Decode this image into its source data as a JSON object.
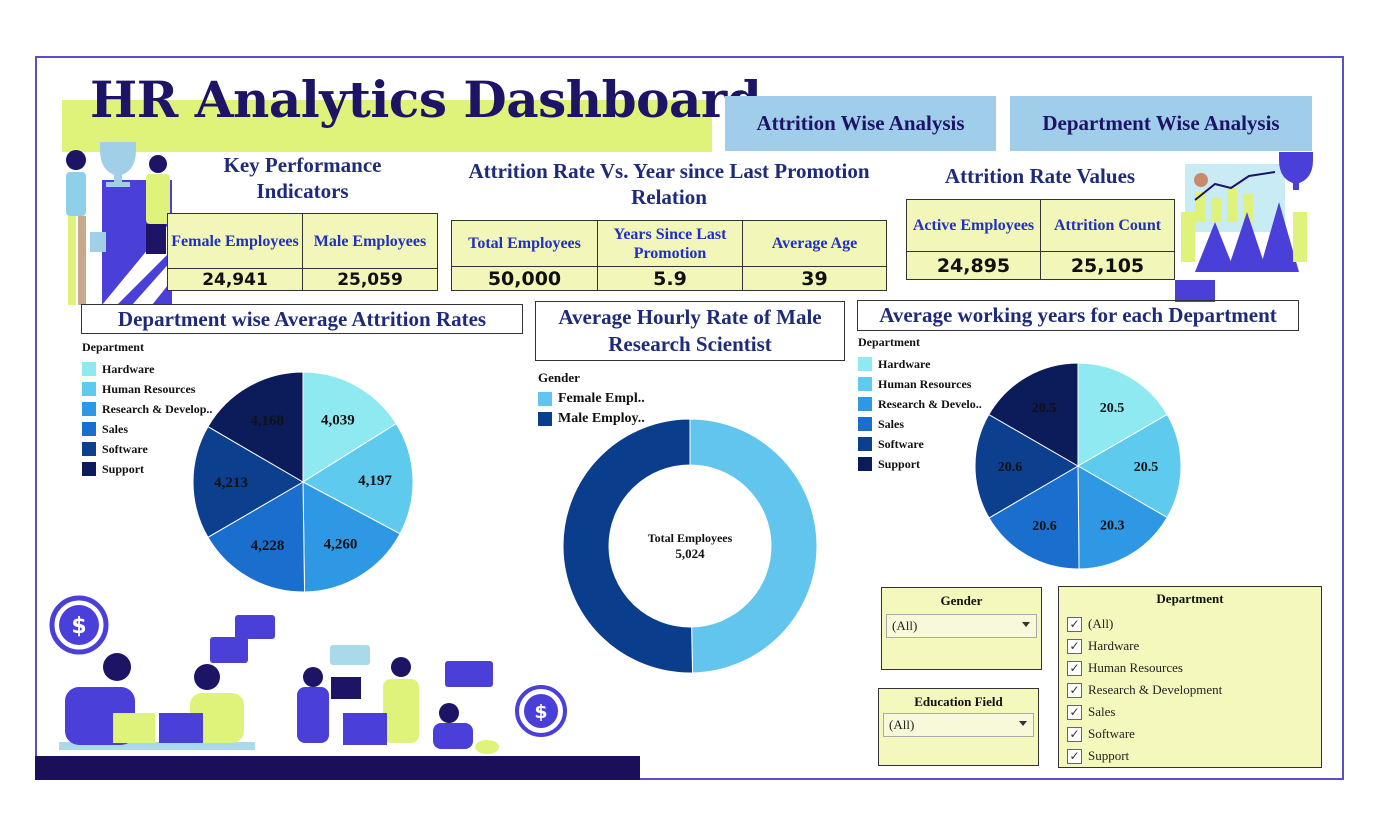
{
  "header": {
    "title": "HR Analytics Dashboard"
  },
  "nav": {
    "attrition_btn": "Attrition Wise Analysis",
    "department_btn": "Department Wise Analysis"
  },
  "kpi": {
    "heading_line1": "Key Performance",
    "heading_line2": "Indicators",
    "female_label": "Female Employees",
    "male_label": "Male Employees",
    "female_value": "24,941",
    "male_value": "25,059"
  },
  "promotion": {
    "heading_line1": "Attrition Rate Vs. Year since Last Promotion",
    "heading_line2": "Relation",
    "total_label": "Total Employees",
    "years_label": "Years Since Last Promotion",
    "age_label": "Average Age",
    "total_value": "50,000",
    "years_value": "5.9",
    "age_value": "39"
  },
  "attrition_values": {
    "heading": "Attrition Rate Values",
    "active_label": "Active Employees",
    "count_label": "Attrition Count",
    "active_value": "24,895",
    "count_value": "25,105"
  },
  "colors": {
    "hardware": "#8eeaf0",
    "human_resources": "#5ecbee",
    "research": "#2e98e4",
    "sales": "#1a6fce",
    "software": "#0d3f8f",
    "support": "#0c1c5a",
    "female": "#62c5ee",
    "male": "#0a3d8c"
  },
  "chart_data": [
    {
      "type": "pie",
      "title": "Department wise Average Attrition Rates",
      "legend_title": "Department",
      "categories": [
        "Hardware",
        "Human Resources",
        "Research & Develop..",
        "Sales",
        "Software",
        "Support"
      ],
      "values": [
        4039,
        4197,
        4260,
        4228,
        4213,
        4168
      ],
      "labels": [
        "4,039",
        "4,197",
        "4,260",
        "4,228",
        "4,213",
        "4,168"
      ]
    },
    {
      "type": "pie",
      "subtype": "donut",
      "title": "Average Hourly Rate of Male Research Scientist",
      "legend_title": "Gender",
      "categories": [
        "Female Empl..",
        "Male Employ.."
      ],
      "values": [
        2496,
        2528
      ],
      "center_label": "Total Employees",
      "center_value": "5,024"
    },
    {
      "type": "pie",
      "title": "Average working years for each Department",
      "legend_title": "Department",
      "categories": [
        "Hardware",
        "Human Resources",
        "Research & Develo..",
        "Sales",
        "Software",
        "Support"
      ],
      "values": [
        20.5,
        20.5,
        20.3,
        20.6,
        20.6,
        20.5
      ],
      "labels": [
        "20.5",
        "20.5",
        "20.3",
        "20.6",
        "20.6",
        "20.5"
      ]
    }
  ],
  "filters": {
    "gender": {
      "title": "Gender",
      "selected": "(All)"
    },
    "education": {
      "title": "Education Field",
      "selected": "(All)"
    },
    "department": {
      "title": "Department",
      "options": [
        {
          "label": "(All)",
          "checked": true
        },
        {
          "label": "Hardware",
          "checked": true
        },
        {
          "label": "Human Resources",
          "checked": true
        },
        {
          "label": "Research & Development",
          "checked": true
        },
        {
          "label": "Sales",
          "checked": true
        },
        {
          "label": "Software",
          "checked": true
        },
        {
          "label": "Support",
          "checked": true
        }
      ]
    }
  }
}
